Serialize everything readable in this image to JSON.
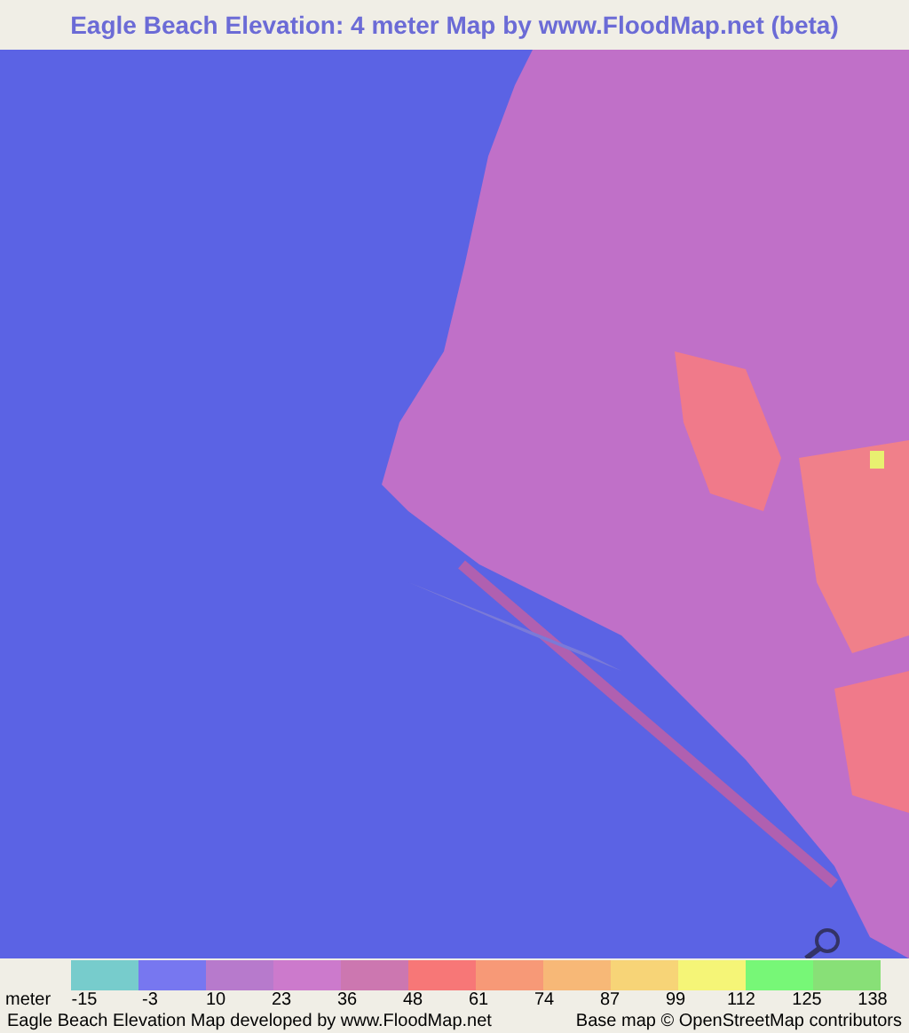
{
  "title": "Eagle Beach Elevation: 4 meter Map by www.FloodMap.net (beta)",
  "legend": {
    "unit": "meter",
    "swatches": [
      {
        "color": "#77cccc"
      },
      {
        "color": "#7777f0"
      },
      {
        "color": "#b77acc"
      },
      {
        "color": "#cc7acc"
      },
      {
        "color": "#cc77b0"
      },
      {
        "color": "#f77777"
      },
      {
        "color": "#f79977"
      },
      {
        "color": "#f7b877"
      },
      {
        "color": "#f7d477"
      },
      {
        "color": "#f5f577"
      },
      {
        "color": "#77f777"
      },
      {
        "color": "#88e077"
      }
    ],
    "ticks": [
      "-15",
      "-3",
      "10",
      "23",
      "36",
      "48",
      "61",
      "74",
      "87",
      "99",
      "112",
      "125",
      "138"
    ]
  },
  "footer": {
    "credit": "Eagle Beach Elevation Map developed by www.FloodMap.net",
    "attribution": "Base map © OpenStreetMap contributors"
  }
}
